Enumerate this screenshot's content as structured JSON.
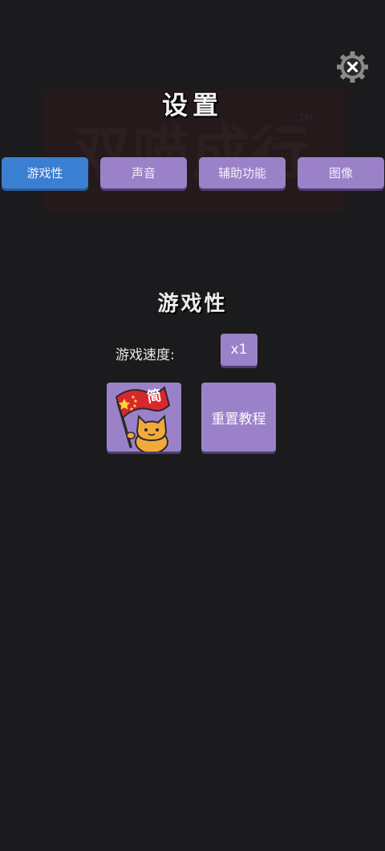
{
  "header": {
    "title": "设置",
    "background_logo_text": "双喵成行",
    "background_logo_mark": "TM"
  },
  "tabs": [
    {
      "label": "游戏性",
      "active": true
    },
    {
      "label": "声音",
      "active": false
    },
    {
      "label": "辅助功能",
      "active": false
    },
    {
      "label": "图像",
      "active": false
    }
  ],
  "gameplay": {
    "section_title": "游戏性",
    "speed_label": "游戏速度:",
    "speed_value": "x1",
    "language_flag_text": "简",
    "reset_tutorial_label": "重置教程"
  },
  "icons": {
    "close": "close-gear-icon",
    "language": "cat-flag-language-icon"
  },
  "colors": {
    "background": "#1b1a1d",
    "tab_active": "#3a7fd2",
    "button": "#9b82c8",
    "flag": "#d8282f",
    "cat": "#f2a93b"
  }
}
